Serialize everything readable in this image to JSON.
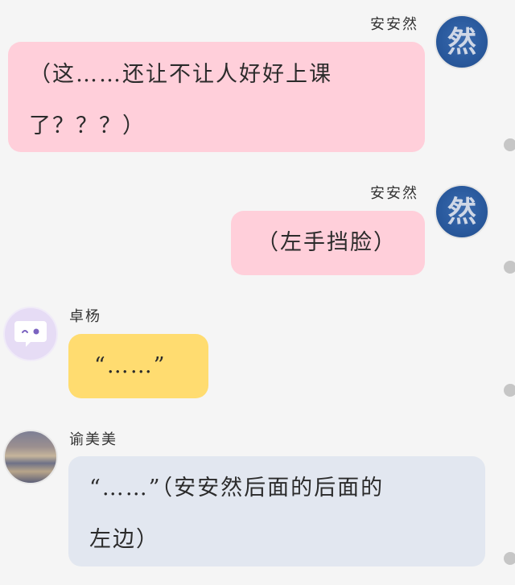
{
  "messages": [
    {
      "sender": "安安然",
      "avatar_text": "然",
      "text_lines": [
        "（这……还让不让人好好上课",
        "了？？？）"
      ]
    },
    {
      "sender": "安安然",
      "avatar_text": "然",
      "text_lines": [
        "（左手挡脸）"
      ]
    },
    {
      "sender": "卓杨",
      "text_lines": [
        "“……”"
      ]
    },
    {
      "sender": "谕美美",
      "text_lines": [
        "“……”（安安然后面的后面的",
        "左边）"
      ]
    }
  ]
}
